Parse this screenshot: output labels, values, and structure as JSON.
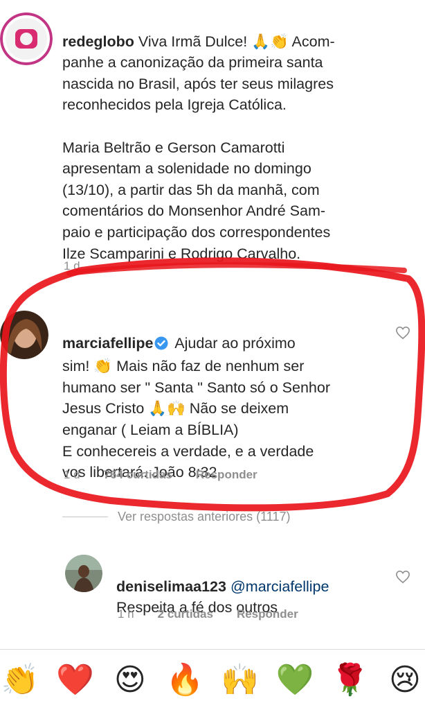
{
  "comments": [
    {
      "username": "redeglobo",
      "text": " Viva Irmã Dulce! 🙏👏 Acom-\npanhe a canonização da primeira santa\nnascida no Brasil, após ter seus milagres\nreconhecidos pela Igreja Católica.\n\nMaria Beltrão e Gerson Camarotti\napresentam a solenidade no domingo\n(13/10), a partir das 5h da manhã, com\ncomentários do Monsenhor André Sam-\npaio e participação dos correspondentes\nIlze Scamparini e Rodrigo Carvalho.",
      "time": "1 d"
    },
    {
      "username": "marciafellipe",
      "text": " Ajudar ao próximo\nsim! 👏 Mais não faz de nenhum ser\nhumano ser \" Santa \" Santo só o Senhor\nJesus Cristo 🙏🙌 Não se deixem\nenganar ( Leiam a BÍBLIA)\nE conhecereis a verdade, e a verdade\nvos libertará. João 8:32",
      "time": "1 d",
      "likes": "764 curtidas",
      "reply": "Responder"
    },
    {
      "username": "deniselimaa123",
      "mention": "@marciafellipe",
      "text": "Respeita a fé dos outros",
      "time": "1 h",
      "likes": "2 curtidas",
      "reply": "Responder"
    }
  ],
  "view_previous": "Ver respostas anteriores (1117)",
  "emoji_bar": [
    "👏",
    "❤️",
    "😍",
    "🔥",
    "🙌",
    "💚",
    "🌹",
    "😢"
  ],
  "colors": {
    "text": "#262626",
    "muted": "#8e8e8e",
    "mention": "#00376b",
    "verified": "#3897f0",
    "annotation_red": "#e8161c"
  }
}
